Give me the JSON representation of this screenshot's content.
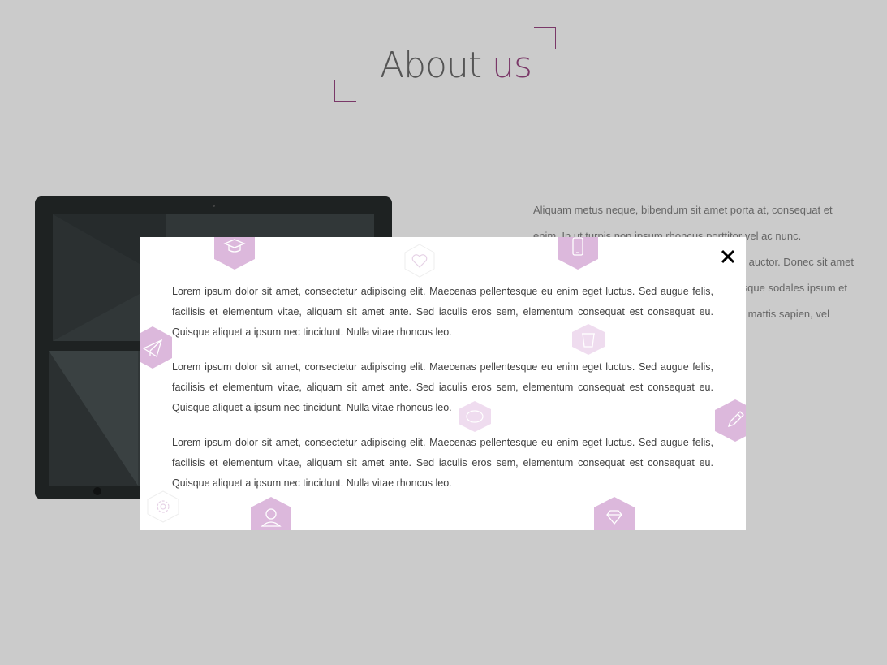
{
  "heading": {
    "title_main": "About ",
    "title_accent": "us"
  },
  "side_paragraph": {
    "line1": "Aliquam metus neque, bibendum sit amet porta at, consequat et",
    "line2": "enim. In ut turpis non ipsum rhoncus porttitor vel ac nunc.",
    "line3": "Donec sit amet auctor. Donec sit amet",
    "line4": "Quisque sodales ipsum et",
    "line5": "mattis sapien, vel"
  },
  "modal": {
    "close_icon": "close-icon",
    "paragraphs": [
      "Lorem ipsum dolor sit amet, consectetur adipiscing elit. Maecenas pellentesque eu enim eget luctus. Sed augue felis, facilisis et elementum vitae, aliquam sit amet ante. Sed iaculis eros sem, elementum consequat est consequat eu. Quisque aliquet a ipsum nec tincidunt. Nulla vitae rhoncus leo.",
      "Lorem ipsum dolor sit amet, consectetur adipiscing elit. Maecenas pellentesque eu enim eget luctus. Sed augue felis, facilisis et elementum vitae, aliquam sit amet ante. Sed iaculis eros sem, elementum consequat est consequat eu. Quisque aliquet a ipsum nec tincidunt. Nulla vitae rhoncus leo.",
      "Lorem ipsum dolor sit amet, consectetur adipiscing elit. Maecenas pellentesque eu enim eget luctus. Sed augue felis, facilisis et elementum vitae, aliquam sit amet ante. Sed iaculis eros sem, elementum consequat est consequat eu. Quisque aliquet a ipsum nec tincidunt. Nulla vitae rhoncus leo."
    ],
    "decor_icons": [
      "graduation-cap-icon",
      "heart-icon",
      "smartphone-icon",
      "paper-plane-icon",
      "coffee-cup-icon",
      "chat-bubble-icon",
      "pencil-icon",
      "gear-icon",
      "user-icon",
      "diamond-icon"
    ]
  },
  "colors": {
    "background": "#cbcbcb",
    "accent": "#7a3868",
    "hex_pink": "#dcb8dc",
    "modal_bg": "#ffffff",
    "device_body": "#1e2222"
  }
}
